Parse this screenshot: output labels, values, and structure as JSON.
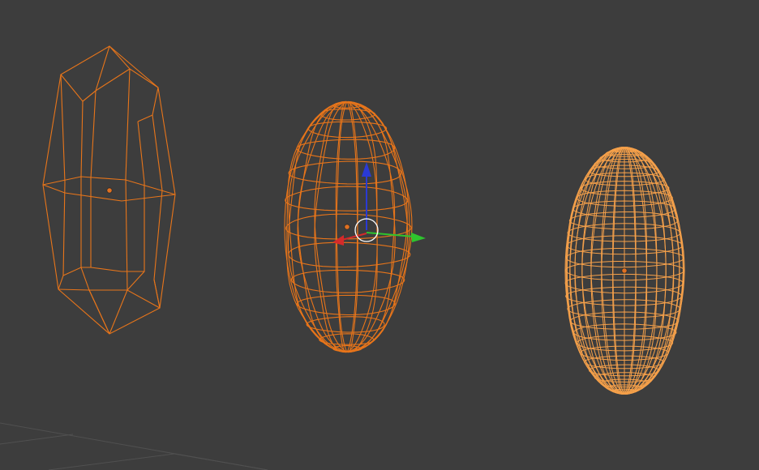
{
  "viewport": {
    "background_color": "#3d3d3d",
    "grid_color": "#505050"
  },
  "objects": [
    {
      "name": "low-poly-ellipsoid",
      "display": "wireframe",
      "selection": "selected",
      "wire_color": "#e8751a",
      "origin_icon": "origin-dot-icon"
    },
    {
      "name": "medium-poly-ellipsoid",
      "display": "wireframe",
      "selection": "active",
      "wire_color": "#e8751a",
      "origin_icon": "origin-dot-icon"
    },
    {
      "name": "high-poly-ellipsoid",
      "display": "wireframe",
      "selection": "active",
      "wire_color": "#f5a04a",
      "origin_icon": "origin-dot-icon"
    }
  ],
  "gizmo": {
    "type": "translate",
    "x_axis_color": "#d42a2a",
    "y_axis_color": "#2ec42e",
    "z_axis_color": "#2a3ad4",
    "center_ring_color": "#ffffff",
    "icons": [
      "x-arrow-icon",
      "y-arrow-icon",
      "z-arrow-icon",
      "center-ring-icon"
    ]
  }
}
